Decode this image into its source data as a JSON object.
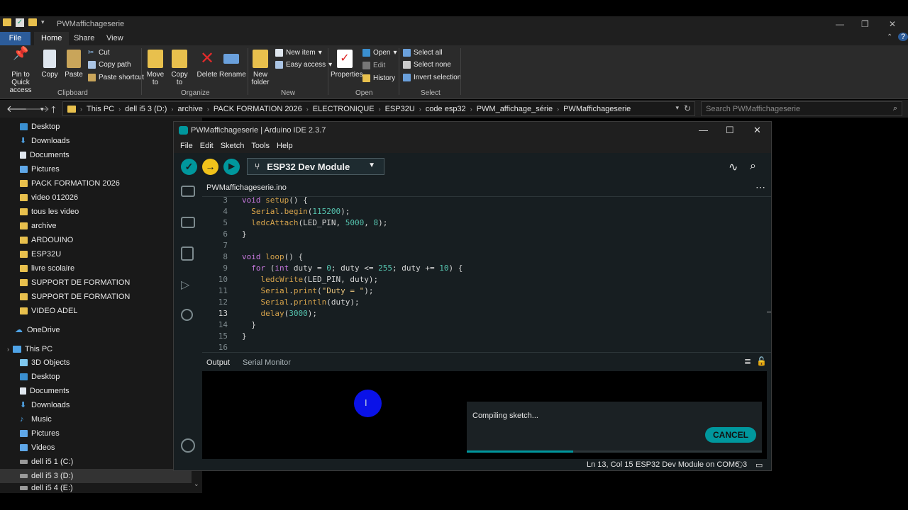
{
  "explorer": {
    "title": "PWMaffichageserie",
    "tabs": [
      "File",
      "Home",
      "Share",
      "View"
    ],
    "ribbon": {
      "clipboard": {
        "label": "Clipboard",
        "pin": "Pin to Quick access",
        "copy": "Copy",
        "paste": "Paste",
        "cut": "Cut",
        "copy_path": "Copy path",
        "paste_shortcut": "Paste shortcut"
      },
      "organize": {
        "label": "Organize",
        "move_to": "Move to",
        "copy_to": "Copy to",
        "delete": "Delete",
        "rename": "Rename"
      },
      "new": {
        "label": "New",
        "new_folder": "New folder",
        "new_item": "New item",
        "easy_access": "Easy access"
      },
      "open": {
        "label": "Open",
        "properties": "Properties",
        "open": "Open",
        "edit": "Edit",
        "history": "History"
      },
      "select": {
        "label": "Select",
        "select_all": "Select all",
        "select_none": "Select none",
        "invert": "Invert selection"
      }
    },
    "breadcrumbs": [
      "This PC",
      "dell i5 3 (D:)",
      "archive",
      "PACK FORMATION 2026",
      "ELECTRONIQUE",
      "ESP32U",
      "code esp32",
      "PWM_affichage_série",
      "PWMaffichageserie"
    ],
    "search_placeholder": "Search PWMaffichageserie",
    "nav_items": [
      {
        "label": "Desktop"
      },
      {
        "label": "Downloads"
      },
      {
        "label": "Documents"
      },
      {
        "label": "Pictures"
      },
      {
        "label": "PACK FORMATION 2026"
      },
      {
        "label": "video 012026"
      },
      {
        "label": "tous les video"
      },
      {
        "label": "archive"
      },
      {
        "label": "ARDOUINO"
      },
      {
        "label": "ESP32U"
      },
      {
        "label": "livre scolaire"
      },
      {
        "label": "SUPPORT DE FORMATION"
      },
      {
        "label": "SUPPORT DE FORMATION"
      },
      {
        "label": "VIDEO ADEL"
      },
      {
        "label": "OneDrive"
      },
      {
        "label": "This PC"
      },
      {
        "label": "3D Objects"
      },
      {
        "label": "Desktop"
      },
      {
        "label": "Documents"
      },
      {
        "label": "Downloads"
      },
      {
        "label": "Music"
      },
      {
        "label": "Pictures"
      },
      {
        "label": "Videos"
      },
      {
        "label": "dell i5 1 (C:)"
      },
      {
        "label": "dell i5 3 (D:)"
      },
      {
        "label": "dell i5 4 (E:)"
      }
    ]
  },
  "ide": {
    "title": "PWMaffichageserie | Arduino IDE 2.3.7",
    "menu": [
      "File",
      "Edit",
      "Sketch",
      "Tools",
      "Help"
    ],
    "board": "ESP32 Dev Module",
    "file_tab": "PWMaffichageserie.ino",
    "line_numbers": [
      "3",
      "4",
      "5",
      "6",
      "7",
      "8",
      "9",
      "10",
      "11",
      "12",
      "13",
      "14",
      "15",
      "16"
    ],
    "output_tab": "Output",
    "serial_tab": "Serial Monitor",
    "toast_message": "Compiling sketch...",
    "cancel_label": "CANCEL",
    "progress": 0.36,
    "status": {
      "position": "Ln 13, Col 15",
      "board_port": "ESP32 Dev Module on COM6",
      "notifications": "3"
    },
    "accent_color": "#00979d"
  }
}
